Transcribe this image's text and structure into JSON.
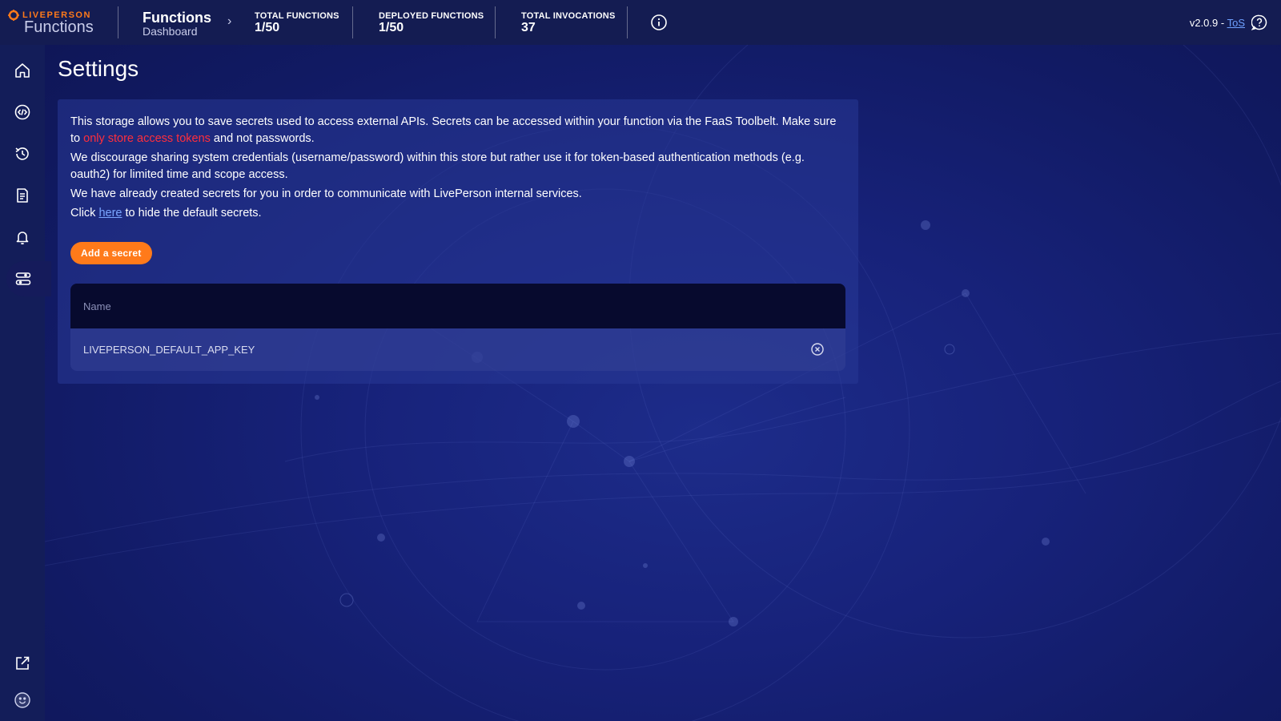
{
  "brand": {
    "company": "LIVEPERSON",
    "product": "Functions"
  },
  "breadcrumb": {
    "title": "Functions",
    "subtitle": "Dashboard"
  },
  "stats": [
    {
      "label": "TOTAL FUNCTIONS",
      "value": "1/50"
    },
    {
      "label": "DEPLOYED FUNCTIONS",
      "value": "1/50"
    },
    {
      "label": "TOTAL INVOCATIONS",
      "value": "37"
    }
  ],
  "header": {
    "version": "v2.0.9 -",
    "tos_label": "ToS"
  },
  "sidebar": {
    "items": [
      {
        "icon": "home-icon"
      },
      {
        "icon": "code-icon"
      },
      {
        "icon": "history-icon"
      },
      {
        "icon": "document-icon"
      },
      {
        "icon": "bell-icon"
      },
      {
        "icon": "settings-icon",
        "active": true
      }
    ],
    "bottom": [
      {
        "icon": "external-link-icon"
      },
      {
        "icon": "smiley-icon"
      }
    ]
  },
  "page": {
    "title": "Settings",
    "description": {
      "p1_before": "This storage allows you to save secrets used to access external APIs. Secrets can be accessed within your function via the FaaS Toolbelt. Make sure to ",
      "p1_warning": "only store access tokens",
      "p1_after": " and not passwords.",
      "p2": "We discourage sharing system credentials (username/password) within this store but rather use it for token-based authentication methods (e.g. oauth2) for limited time and scope access.",
      "p3": "We have already created secrets for you in order to communicate with LivePerson internal services.",
      "p4_before": "Click ",
      "p4_link": "here",
      "p4_after": " to hide the default secrets."
    },
    "add_button": "Add a secret",
    "table": {
      "header": "Name",
      "rows": [
        {
          "name": "LIVEPERSON_DEFAULT_APP_KEY"
        }
      ]
    }
  },
  "colors": {
    "accent": "#ff7a1a",
    "warning": "#ff2e3c",
    "link": "#7aa6ff"
  }
}
